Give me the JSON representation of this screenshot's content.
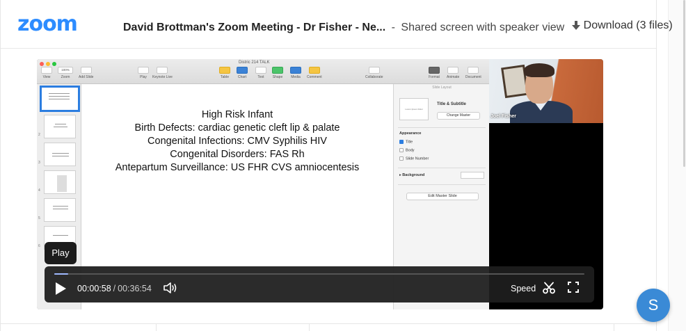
{
  "app": {
    "logo_text": "zoom",
    "brand_color": "#2d8cff"
  },
  "header": {
    "meeting_title": "David Brottman's Zoom Meeting - Dr Fisher - Ne...",
    "separator": "-",
    "description": "Shared screen with speaker view",
    "download_label": "Download (3 files)",
    "download_icon": "download-arrow-icon"
  },
  "keynote": {
    "document_title": "Distric 214 TALK",
    "toolbar": [
      "View",
      "Zoom",
      "Add Slide",
      "Play",
      "Keynote Live",
      "Table",
      "Chart",
      "Text",
      "Shape",
      "Media",
      "Comment",
      "Collaborate",
      "Format",
      "Animate",
      "Document"
    ],
    "zoom_value": "100%",
    "slide_numbers": [
      "1",
      "2",
      "3",
      "4",
      "5",
      "6"
    ],
    "slide_lines": [
      "High Risk Infant",
      "Birth Defects: cardiac genetic cleft lip & palate",
      "Congenital Infections: CMV Syphilis HIV",
      "Congenital Disorders: FAS Rh",
      "Antepartum Surveillance: US FHR CVS amniocentesis"
    ],
    "inspector": {
      "header": "Slide Layout",
      "thumb_caption": "Lorem Ipsum Dolor",
      "layout_name": "Title & Subtitle",
      "change_master": "Change Master",
      "appearance": "Appearance",
      "options": [
        {
          "label": "Title",
          "checked": true
        },
        {
          "label": "Body",
          "checked": false
        },
        {
          "label": "Slide Number",
          "checked": false
        }
      ],
      "background": "Background",
      "edit_master": "Edit Master Slide"
    }
  },
  "speaker": {
    "name": "Joel Fisher"
  },
  "player": {
    "tooltip": "Play",
    "current_time": "00:00:58",
    "time_separator": "/",
    "total_time": "00:36:54",
    "progress": 0.026,
    "speed_label": "Speed"
  },
  "avatar": {
    "initial": "S",
    "color": "#3a8ad6"
  }
}
